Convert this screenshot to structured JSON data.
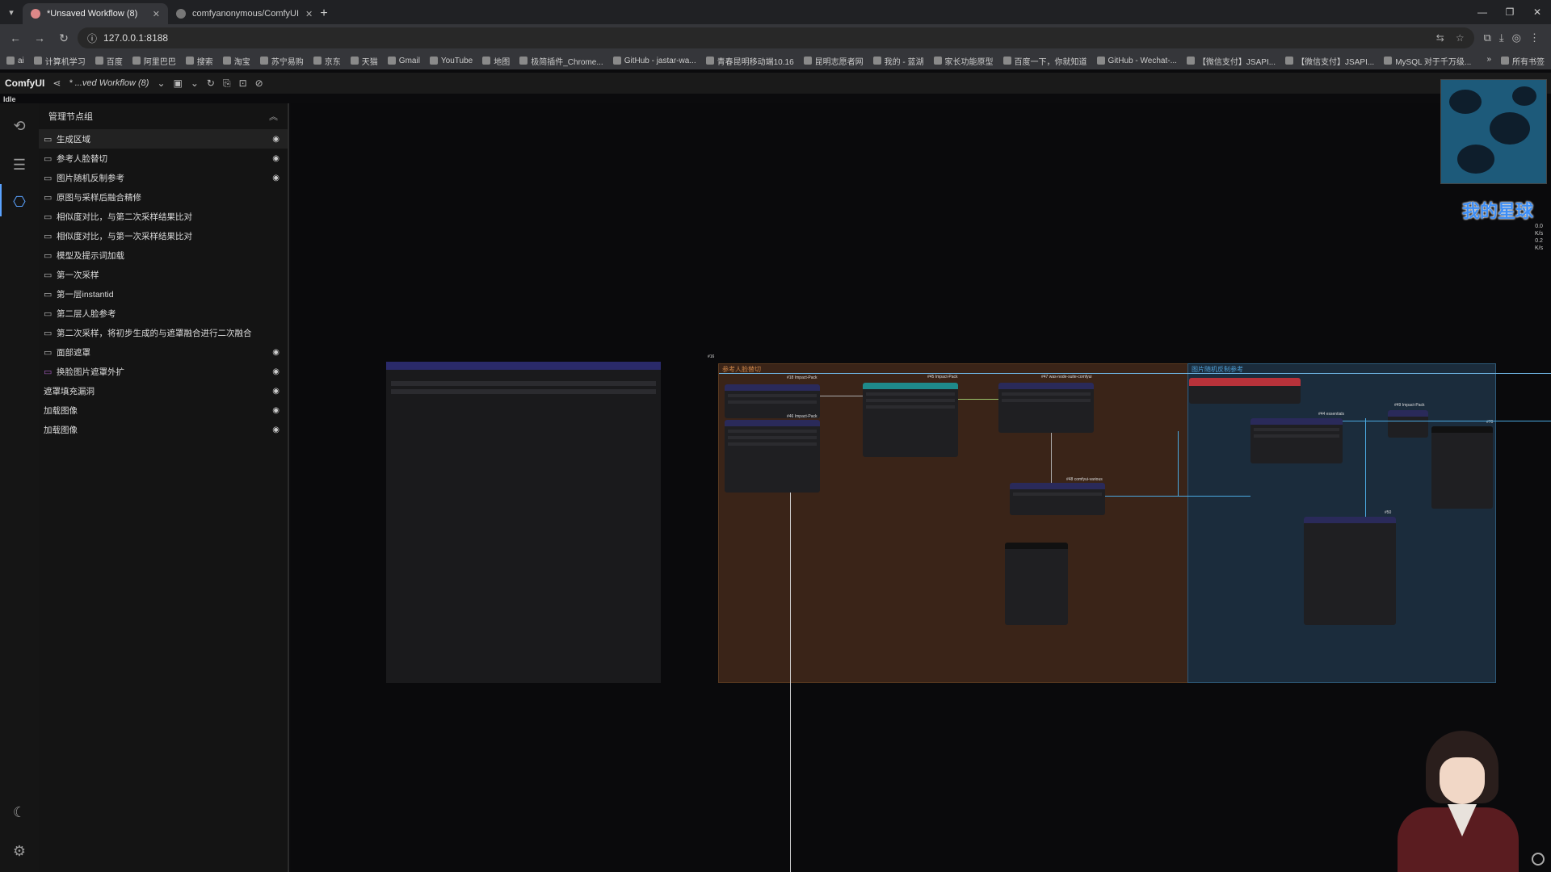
{
  "browser": {
    "tabs": [
      {
        "title": "*Unsaved Workflow (8)",
        "active": true
      },
      {
        "title": "comfyanonymous/ComfyUI",
        "active": false
      }
    ],
    "url": "127.0.0.1:8188",
    "bookmarks": [
      "ai",
      "计算机学习",
      "百度",
      "阿里巴巴",
      "搜索",
      "淘宝",
      "苏宁易购",
      "京东",
      "天猫",
      "Gmail",
      "YouTube",
      "地图",
      "极简插件_Chrome...",
      "GitHub - jastar-wa...",
      "青春昆明移动端10.16",
      "昆明志愿者网",
      "我的 - 蓝湖",
      "家长功能原型",
      "百度一下，你就知道",
      "GitHub - Wechat-...",
      "【微信支付】JSAPI...",
      "【微信支付】JSAPI...",
      "MySQL 对于千万级..."
    ],
    "bookmarks_more": "»",
    "all_bookmarks": "所有书签"
  },
  "comfy": {
    "brand": "ComfyUI",
    "workflow": "* ...ved Workflow (8)",
    "status": "Idle"
  },
  "panel": {
    "title": "管理节点组",
    "groups": [
      {
        "label": "生成区域",
        "folder": true,
        "eye": true,
        "hover": true
      },
      {
        "label": "参考人脸替切",
        "folder": true,
        "eye": true
      },
      {
        "label": "图片随机反制参考",
        "folder": true,
        "eye": true
      },
      {
        "label": "原图与采样后融合精修",
        "folder": true,
        "eye": false
      },
      {
        "label": "相似度对比，与第二次采样结果比对",
        "folder": true,
        "eye": false
      },
      {
        "label": "相似度对比，与第一次采样结果比对",
        "folder": true,
        "eye": false
      },
      {
        "label": "模型及提示词加载",
        "folder": true,
        "eye": false
      },
      {
        "label": "第一次采样",
        "folder": true,
        "eye": false
      },
      {
        "label": "第一层instantid",
        "folder": true,
        "eye": false
      },
      {
        "label": "第二层人脸参考",
        "folder": true,
        "eye": false
      },
      {
        "label": "第二次采样，将初步生成的与遮罩融合进行二次融合",
        "folder": true,
        "eye": false
      },
      {
        "label": "面部遮罩",
        "folder": true,
        "eye": true
      },
      {
        "label": "换脸图片遮罩外扩",
        "folder": true,
        "eye": true,
        "accent": true
      },
      {
        "label": "遮罩填充漏洞",
        "folder": false,
        "eye": true
      },
      {
        "label": "加载图像",
        "folder": false,
        "eye": true
      },
      {
        "label": "加载图像",
        "folder": false,
        "eye": true
      }
    ]
  },
  "canvas": {
    "groups": [
      {
        "title": "参考人脸替切",
        "color": "#a8652a"
      },
      {
        "title": "图片随机反制参考",
        "color": "#3d86b8"
      }
    ],
    "node_titles": [
      "#18 Impact-Pack",
      "#46 Impact-Pack",
      "#45 Impact-Pack",
      "#47 was-node-suite-comfyui",
      "#48 comfyui-various",
      "#44 essentials",
      "#49 Impact-Pack",
      "#50",
      "#70",
      "#16"
    ]
  },
  "overlay": {
    "planet": "我的星球",
    "stats": [
      "0.0",
      "K/s",
      "0.2",
      "K/s"
    ]
  },
  "colors": {
    "accent": "#5aa2ff",
    "group_orange": "#3a2418",
    "group_blue": "#1b2c3c"
  }
}
